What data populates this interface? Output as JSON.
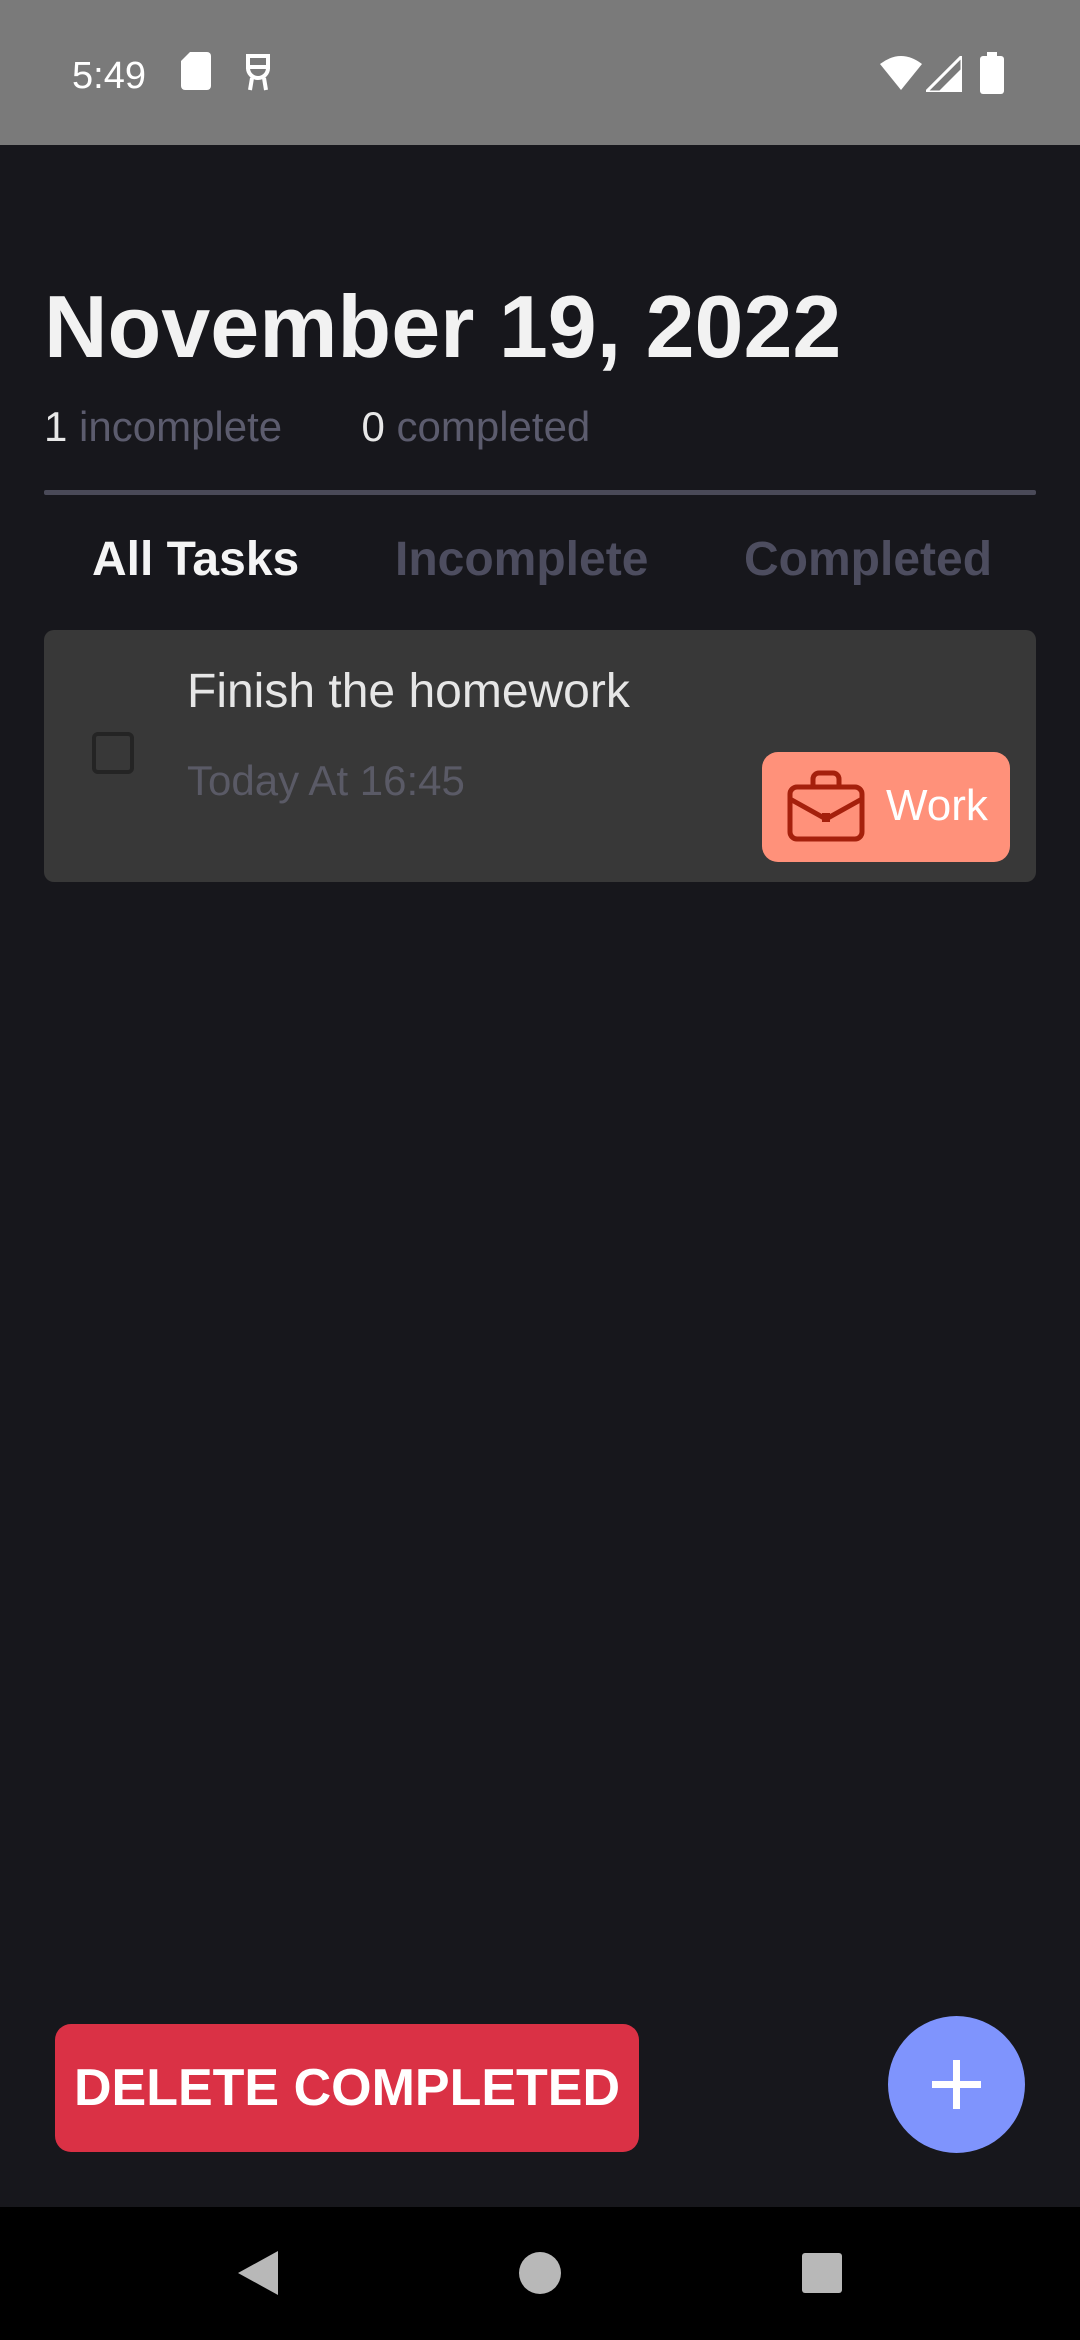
{
  "status_bar": {
    "time": "5:49",
    "icons_left": [
      "sd-card-icon",
      "accessibility-icon"
    ],
    "icons_right": [
      "wifi-icon",
      "cell-signal-icon",
      "battery-icon"
    ]
  },
  "header": {
    "date": "November 19, 2022",
    "incomplete_count": "1",
    "incomplete_label": "incomplete",
    "completed_count": "0",
    "completed_label": "completed"
  },
  "tabs": [
    {
      "label": "All Tasks",
      "active": true
    },
    {
      "label": "Incomplete",
      "active": false
    },
    {
      "label": "Completed",
      "active": false
    }
  ],
  "tasks": [
    {
      "title": "Finish the homework",
      "time": "Today At 16:45",
      "checked": false,
      "category": {
        "label": "Work",
        "icon": "briefcase-icon",
        "color": "#ff917a"
      }
    }
  ],
  "actions": {
    "delete_completed_label": "DELETE COMPLETED",
    "add_icon": "plus-icon"
  },
  "nav_bar": {
    "buttons": [
      "back-icon",
      "home-icon",
      "recents-icon"
    ]
  },
  "colors": {
    "background": "#17171c",
    "card": "#383838",
    "accent": "#7f94fd",
    "danger": "#da3145",
    "work": "#ff917a"
  }
}
